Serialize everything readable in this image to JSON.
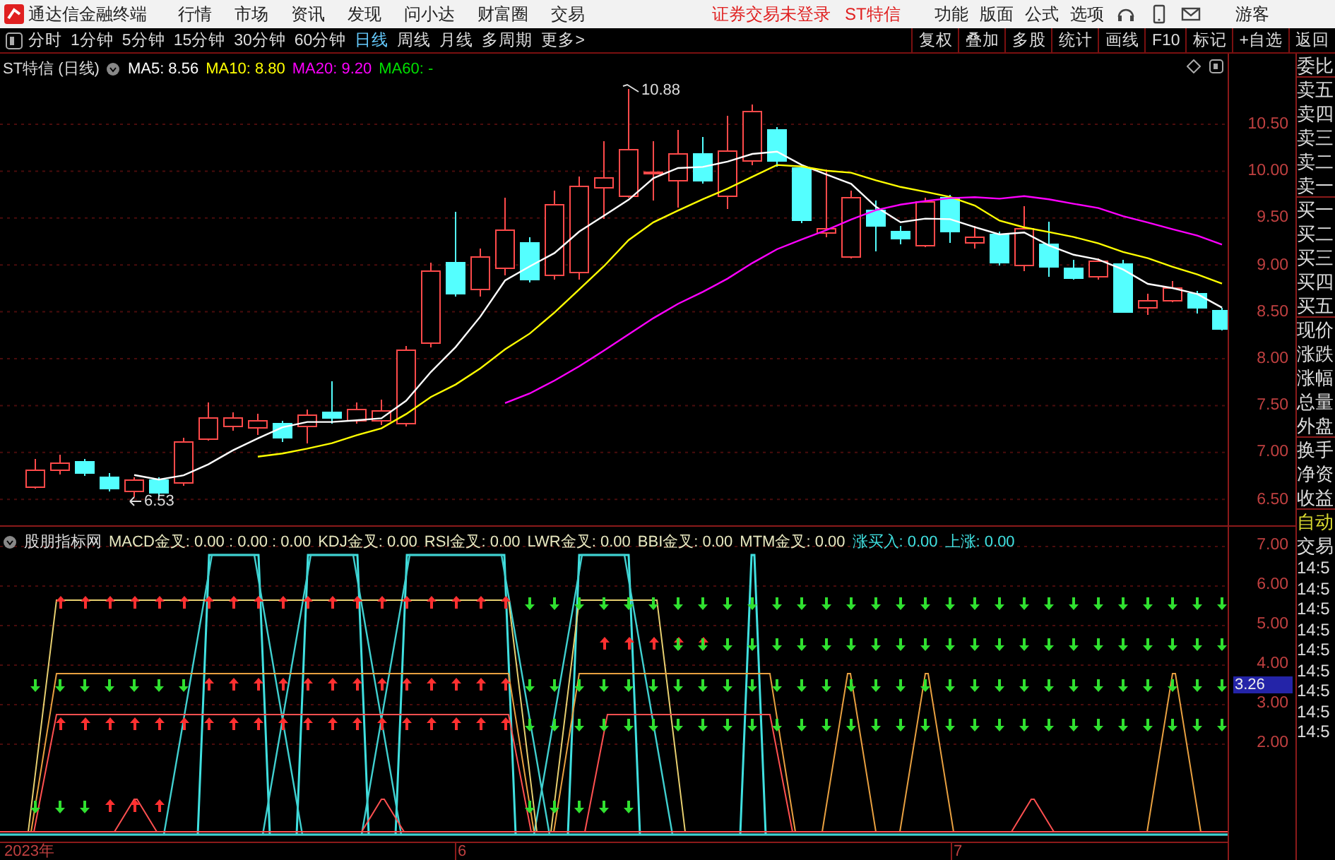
{
  "app": {
    "title": "通达信金融终端",
    "menu": [
      "行情",
      "市场",
      "资讯",
      "发现",
      "问小达",
      "财富圈",
      "交易"
    ],
    "notices": [
      "证券交易未登录",
      "ST特信"
    ],
    "tools": [
      "功能",
      "版面",
      "公式",
      "选项"
    ],
    "user": "游客"
  },
  "toolbar": {
    "periods": [
      {
        "label": "分时",
        "selected": false
      },
      {
        "label": "1分钟",
        "selected": false
      },
      {
        "label": "5分钟",
        "selected": false
      },
      {
        "label": "15分钟",
        "selected": false
      },
      {
        "label": "30分钟",
        "selected": false
      },
      {
        "label": "60分钟",
        "selected": false
      },
      {
        "label": "日线",
        "selected": true
      },
      {
        "label": "周线",
        "selected": false
      },
      {
        "label": "月线",
        "selected": false
      },
      {
        "label": "多周期",
        "selected": false
      },
      {
        "label": "更多>",
        "selected": false
      }
    ],
    "buttons": [
      "复权",
      "叠加",
      "多股",
      "统计",
      "画线",
      "F10",
      "标记",
      "+自选",
      "返回"
    ]
  },
  "chart": {
    "title": "ST特信 (日线)",
    "ma": [
      {
        "label": "MA5: 8.56",
        "color": "#ffffff"
      },
      {
        "label": "MA10: 8.80",
        "color": "#ffff00"
      },
      {
        "label": "MA20: 9.20",
        "color": "#ff00ff"
      },
      {
        "label": "MA60: -",
        "color": "#00e000"
      }
    ],
    "high_label": "10.88",
    "low_label": "6.53",
    "price_ticks": [
      "10.50",
      "10.00",
      "9.50",
      "9.00",
      "8.50",
      "8.00",
      "7.50",
      "7.00",
      "6.50"
    ]
  },
  "indicator": {
    "name": "股朋指标网",
    "values": [
      {
        "text": "MACD金叉: 0.00 : 0.00 : 0.00",
        "color": "#e8e8c0"
      },
      {
        "text": "KDJ金叉: 0.00",
        "color": "#e8e8c0"
      },
      {
        "text": "RSI金叉: 0.00",
        "color": "#e8e8c0"
      },
      {
        "text": "LWR金叉: 0.00",
        "color": "#e8e8c0"
      },
      {
        "text": "BBI金叉: 0.00",
        "color": "#e8e8c0"
      },
      {
        "text": "MTM金叉: 0.00",
        "color": "#e8e8c0"
      },
      {
        "text": "涨买入: 0.00",
        "color": "#40e0e0"
      },
      {
        "text": "上涨: 0.00",
        "color": "#40e0e0"
      }
    ],
    "ticks": [
      "7.00",
      "6.00",
      "5.00",
      "4.00",
      "3.00",
      "2.00"
    ],
    "marker": "3.26"
  },
  "dates": [
    "2023年",
    "6",
    "7"
  ],
  "quote_panel": {
    "fields": [
      "委比",
      "卖五",
      "卖四",
      "卖三",
      "卖二",
      "卖一",
      "买一",
      "买二",
      "买三",
      "买四",
      "买五",
      "现价",
      "涨跌",
      "涨幅",
      "总量",
      "外盘",
      "换手",
      "净资",
      "收益"
    ],
    "mode": "自动",
    "trade": "交易",
    "times": [
      "14:5",
      "14:5",
      "14:5",
      "14:5",
      "14:5",
      "14:5",
      "14:5",
      "14:5",
      "14:5"
    ]
  }
}
